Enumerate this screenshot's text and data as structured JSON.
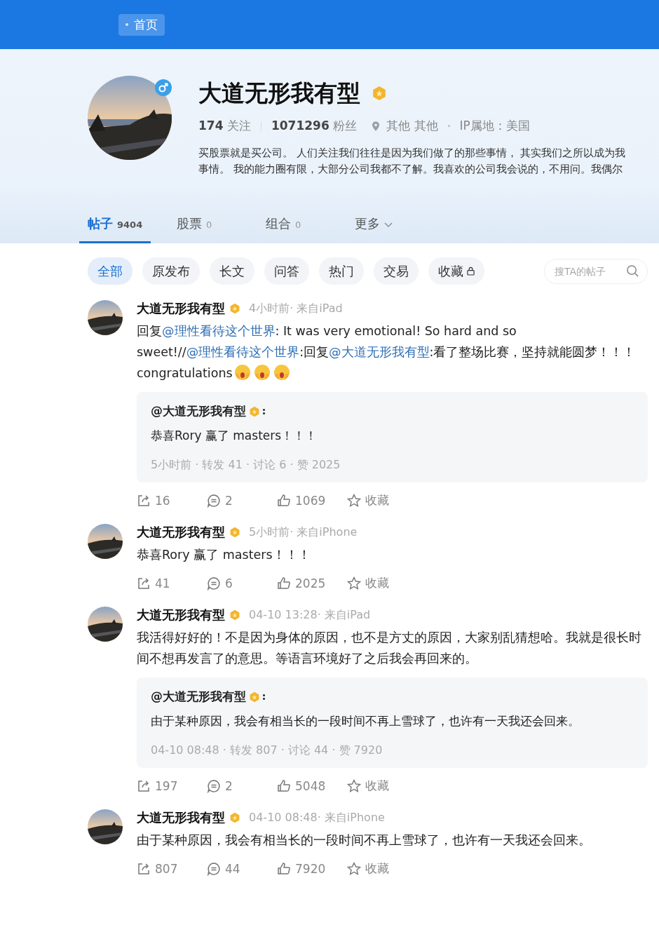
{
  "top_bar": {
    "home_button": "首页"
  },
  "profile": {
    "name": "大道无形我有型",
    "following_count": "174",
    "following_label": "关注",
    "followers_count": "1071296",
    "followers_label": "粉丝",
    "location": "其他 其他",
    "ip": "IP属地：美国",
    "bio": [
      "买股票就是买公司。 人们关注我们往往是因为我们做了的那些事情， 其实我们之所以成为我",
      "事情。 我的能力圈有限，大部分公司我都不了解。我喜欢的公司我会说的，不用问。我偶尔"
    ]
  },
  "tabs": [
    {
      "kind": "tab",
      "label": "帖子",
      "count": "9404",
      "selected": true
    },
    {
      "kind": "tab",
      "label": "股票",
      "count": "0",
      "selected": false
    },
    {
      "kind": "tab",
      "label": "组合",
      "count": "0",
      "selected": false
    },
    {
      "kind": "menu",
      "label": "更多",
      "selected": false
    }
  ],
  "filters": [
    {
      "label": "全部",
      "selected": true,
      "locked": false
    },
    {
      "label": "原发布",
      "selected": false,
      "locked": false
    },
    {
      "label": "长文",
      "selected": false,
      "locked": false
    },
    {
      "label": "问答",
      "selected": false,
      "locked": false
    },
    {
      "label": "热门",
      "selected": false,
      "locked": false
    },
    {
      "label": "交易",
      "selected": false,
      "locked": false
    },
    {
      "label": "收藏",
      "selected": false,
      "locked": true
    }
  ],
  "search": {
    "placeholder": "搜TA的帖子"
  },
  "posts": [
    {
      "author": "大道无形我有型",
      "meta": "4小时前· 来自iPad",
      "content": [
        {
          "kind": "text",
          "text": "回复"
        },
        {
          "kind": "mention",
          "text": "@理性看待这个世界"
        },
        {
          "kind": "text",
          "text": ": It was very emotional! So hard and so sweet!//"
        },
        {
          "kind": "mention",
          "text": "@理性看待这个世界"
        },
        {
          "kind": "text",
          "text": ":回复"
        },
        {
          "kind": "mention",
          "text": "@大道无形我有型"
        },
        {
          "kind": "text",
          "text": ":看了整场比赛，坚持就能圆梦！！！ congratulations"
        },
        {
          "kind": "emoji"
        },
        {
          "kind": "emoji"
        },
        {
          "kind": "emoji"
        }
      ],
      "quote": {
        "author": "@大道无形我有型",
        "text": "恭喜Rory 赢了 masters！！！",
        "meta": "5小时前  · 转发 41 · 讨论 6 · 赞 2025"
      },
      "reposts": "16",
      "comments": "2",
      "likes": "1069",
      "favorite": "收藏"
    },
    {
      "author": "大道无形我有型",
      "meta": "5小时前· 来自iPhone",
      "content": [
        {
          "kind": "text",
          "text": "恭喜Rory 赢了 masters！！！"
        }
      ],
      "reposts": "41",
      "comments": "6",
      "likes": "2025",
      "favorite": "收藏"
    },
    {
      "author": "大道无形我有型",
      "meta": "04-10 13:28· 来自iPad",
      "content": [
        {
          "kind": "text",
          "text": "我活得好好的！不是因为身体的原因，也不是方丈的原因，大家别乱猜想哈。我就是很长时间不想再发言了的意思。等语言环境好了之后我会再回来的。"
        }
      ],
      "quote": {
        "author": "@大道无形我有型",
        "text": "由于某种原因，我会有相当长的一段时间不再上雪球了，也许有一天我还会回来。",
        "meta": "04-10 08:48  · 转发 807 · 讨论 44 · 赞 7920"
      },
      "reposts": "197",
      "comments": "2",
      "likes": "5048",
      "favorite": "收藏"
    },
    {
      "author": "大道无形我有型",
      "meta": "04-10 08:48· 来自iPhone",
      "content": [
        {
          "kind": "text",
          "text": "由于某种原因，我会有相当长的一段时间不再上雪球了，也许有一天我还会回来。"
        }
      ],
      "reposts": "807",
      "comments": "44",
      "likes": "7920",
      "favorite": "收藏"
    }
  ]
}
